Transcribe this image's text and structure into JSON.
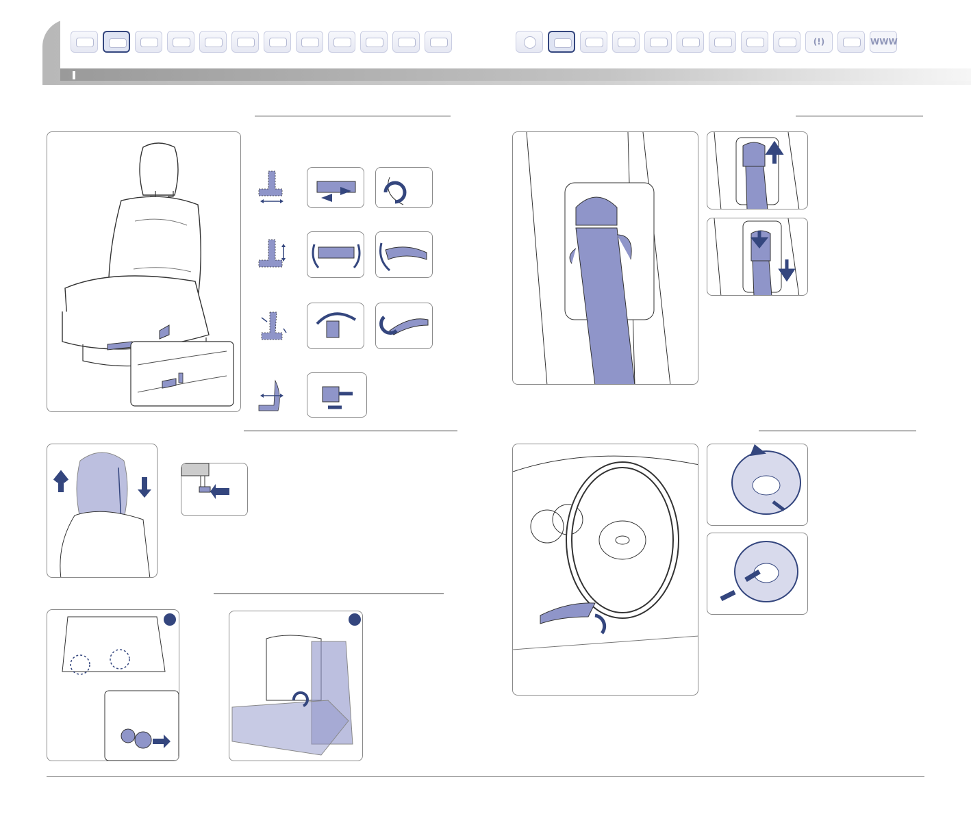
{
  "header": {
    "left_nav_icons": [
      "meter-icon",
      "seat-icon",
      "key-icon",
      "cluster-icon",
      "climate-icon",
      "audio-icon",
      "radio-icon",
      "display-icon",
      "car-icon",
      "wiper-icon",
      "screen-icon",
      "hand-icon"
    ],
    "right_nav_icons": [
      "start-button-icon",
      "seat-active-icon",
      "pen-icon",
      "cluster-icon",
      "climate-icon",
      "audio-icon",
      "display-icon",
      "radio-icon",
      "console-icon",
      "tpms-icon",
      "hand-icon",
      "web-icon"
    ],
    "tpms_label": "(!)",
    "web_label": "WWW",
    "active_left_index": 1,
    "active_right_index": 1
  },
  "colors": {
    "accent": "#34467e",
    "part_fill": "#8f95c9",
    "line": "#333333"
  }
}
